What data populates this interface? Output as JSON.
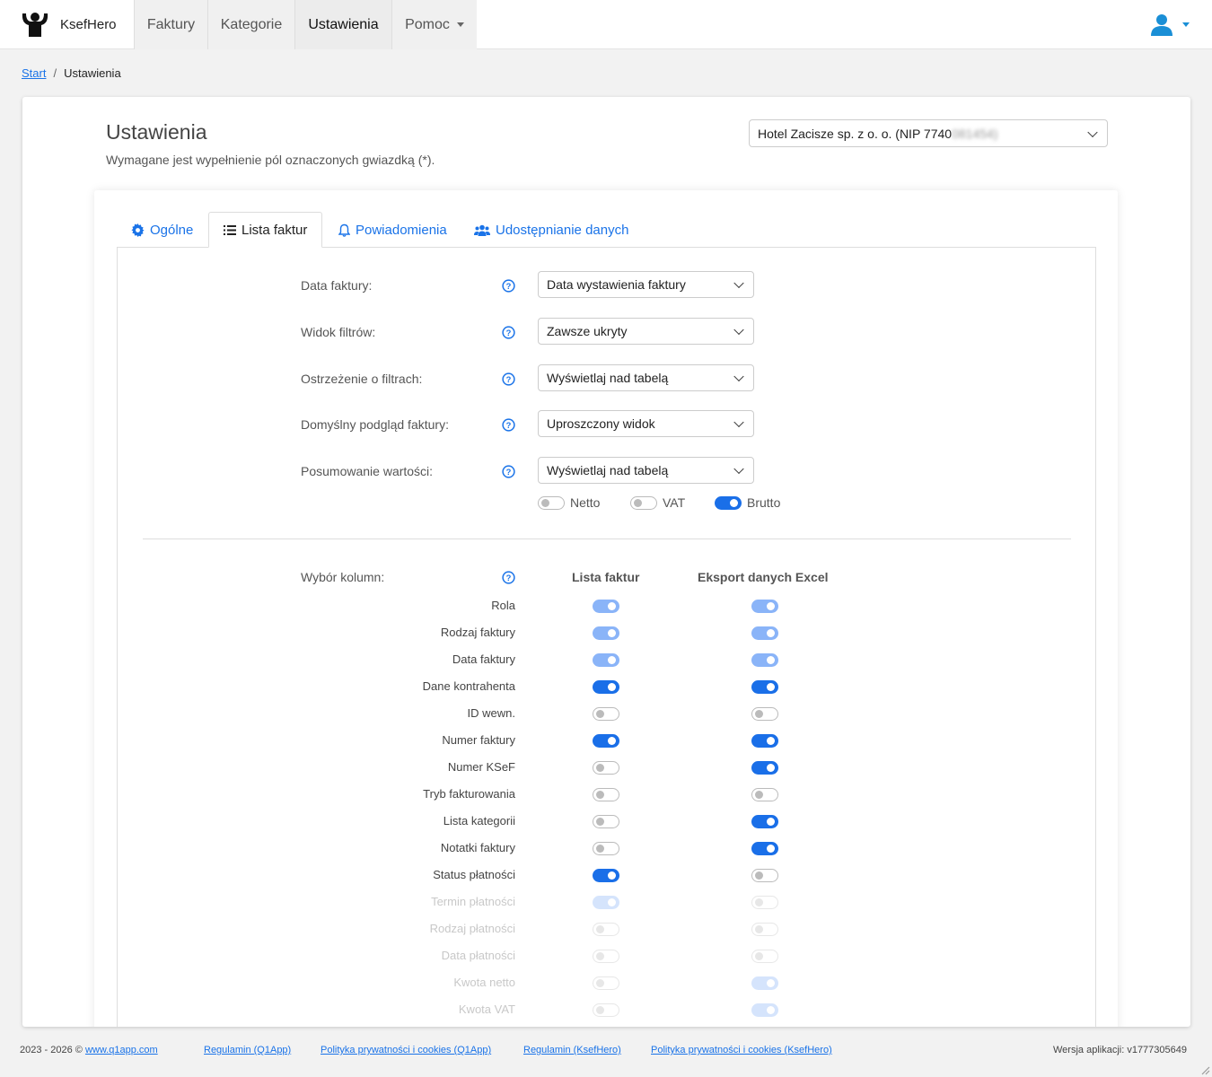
{
  "navbar": {
    "brand": "KsefHero",
    "items": [
      {
        "label": "Faktury"
      },
      {
        "label": "Kategorie"
      },
      {
        "label": "Ustawienia"
      },
      {
        "label": "Pomoc"
      }
    ]
  },
  "breadcrumb": {
    "home": "Start",
    "separator": "/",
    "current": "Ustawienia"
  },
  "header": {
    "title": "Ustawienia",
    "subtitle": "Wymagane jest wypełnienie pól oznaczonych gwiazdką (*).",
    "company_visible": "Hotel Zacisze sp. z o. o. (NIP 7740",
    "company_blurred": "081454)"
  },
  "tabs": [
    {
      "label": "Ogólne",
      "icon": "gear-icon"
    },
    {
      "label": "Lista faktur",
      "icon": "list-icon"
    },
    {
      "label": "Powiadomienia",
      "icon": "bell-icon"
    },
    {
      "label": "Udostępnianie danych",
      "icon": "users-icon"
    }
  ],
  "settings": [
    {
      "label": "Data faktury:",
      "value": "Data wystawienia faktury"
    },
    {
      "label": "Widok filtrów:",
      "value": "Zawsze ukryty"
    },
    {
      "label": "Ostrzeżenie o filtrach:",
      "value": "Wyświetlaj nad tabelą"
    },
    {
      "label": "Domyślny podgląd faktury:",
      "value": "Uproszczony widok"
    },
    {
      "label": "Posumowanie wartości:",
      "value": "Wyświetlaj nad tabelą"
    }
  ],
  "summary_toggles": [
    {
      "label": "Netto",
      "on": false
    },
    {
      "label": "VAT",
      "on": false
    },
    {
      "label": "Brutto",
      "on": true
    }
  ],
  "columns": {
    "label": "Wybór kolumn:",
    "head_list": "Lista faktur",
    "head_excel": "Eksport danych Excel",
    "rows": [
      {
        "label": "Rola",
        "list": "disabled-on",
        "excel": "disabled-on"
      },
      {
        "label": "Rodzaj faktury",
        "list": "disabled-on",
        "excel": "disabled-on"
      },
      {
        "label": "Data faktury",
        "list": "disabled-on",
        "excel": "disabled-on"
      },
      {
        "label": "Dane kontrahenta",
        "list": "on",
        "excel": "on"
      },
      {
        "label": "ID wewn.",
        "list": "off",
        "excel": "off"
      },
      {
        "label": "Numer faktury",
        "list": "on",
        "excel": "on"
      },
      {
        "label": "Numer KSeF",
        "list": "off",
        "excel": "on"
      },
      {
        "label": "Tryb fakturowania",
        "list": "off",
        "excel": "off"
      },
      {
        "label": "Lista kategorii",
        "list": "off",
        "excel": "on"
      },
      {
        "label": "Notatki faktury",
        "list": "off",
        "excel": "on"
      },
      {
        "label": "Status płatności",
        "list": "on",
        "excel": "off"
      },
      {
        "label": "Termin płatności",
        "list": "disabled-on",
        "excel": "off",
        "faded": true
      },
      {
        "label": "Rodzaj płatności",
        "list": "off",
        "excel": "off",
        "faded": true
      },
      {
        "label": "Data płatności",
        "list": "off",
        "excel": "off",
        "faded": true
      },
      {
        "label": "Kwota netto",
        "list": "off",
        "excel": "disabled-on",
        "faded": true
      },
      {
        "label": "Kwota VAT",
        "list": "off",
        "excel": "disabled-on",
        "faded": true
      }
    ]
  },
  "footer": {
    "copyright": "2023 - 2026 ©",
    "site_link": "www.q1app.com",
    "links": [
      "Regulamin (Q1App)",
      "Polityka prywatności i cookies (Q1App)",
      "Regulamin (KsefHero)",
      "Polityka prywatności i cookies (KsefHero)"
    ],
    "version": "Wersja aplikacji: v1777305649"
  },
  "colors": {
    "accent": "#1a6fe8",
    "link": "#1a73e8",
    "user_icon": "#1a8fd6"
  }
}
